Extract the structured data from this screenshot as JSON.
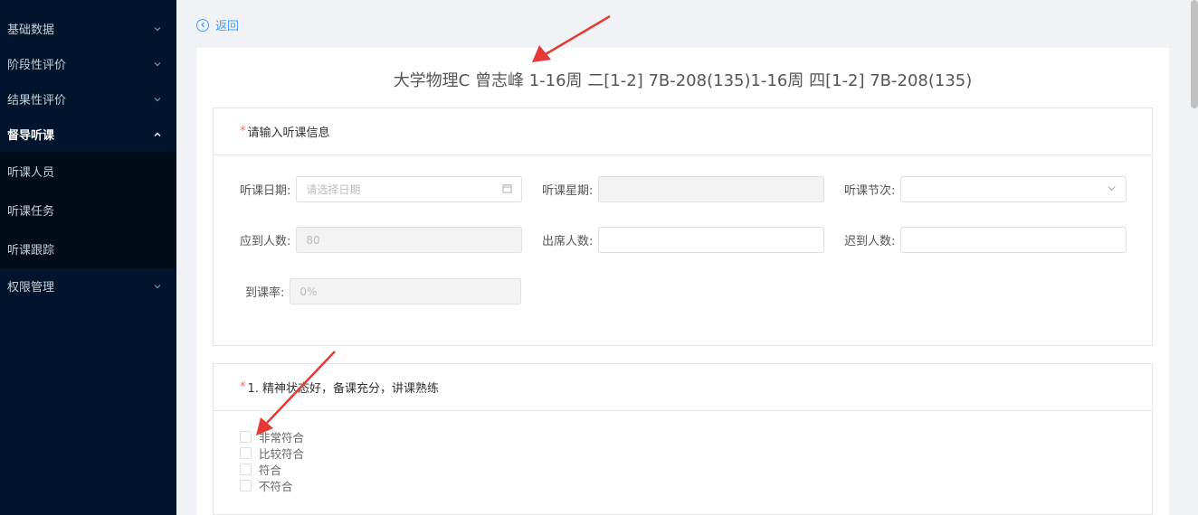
{
  "sidebar": {
    "items": [
      {
        "label": "基础数据",
        "chevron": "down"
      },
      {
        "label": "阶段性评价",
        "chevron": "down"
      },
      {
        "label": "结果性评价",
        "chevron": "down"
      },
      {
        "label": "督导听课",
        "chevron": "up",
        "active": true
      },
      {
        "label": "权限管理",
        "chevron": "down"
      }
    ],
    "submenu": [
      "听课人员",
      "听课任务",
      "听课跟踪"
    ]
  },
  "back_label": "返回",
  "course_title": "大学物理C 曾志峰 1-16周 二[1-2] 7B-208(135)1-16周 四[1-2] 7B-208(135)",
  "info_panel": {
    "required_mark": "*",
    "heading": "请输入听课信息",
    "fields": {
      "date": {
        "label": "听课日期:",
        "placeholder": "请选择日期",
        "icon": "calendar-icon"
      },
      "weekday": {
        "label": "听课星期:",
        "value": ""
      },
      "period": {
        "label": "听课节次:",
        "value": "",
        "icon": "chevron-down-icon"
      },
      "expected": {
        "label": "应到人数:",
        "value": "80"
      },
      "present": {
        "label": "出席人数:",
        "value": ""
      },
      "late": {
        "label": "迟到人数:",
        "value": ""
      },
      "rate": {
        "label": "到课率:",
        "value": "0%"
      }
    }
  },
  "question_panel": {
    "required_mark": "*",
    "heading": "1. 精神状态好，备课充分，讲课熟练",
    "options": [
      "非常符合",
      "比较符合",
      "符合",
      "不符合"
    ]
  },
  "colors": {
    "sidebar_bg": "#00152d",
    "submenu_bg": "#000c17",
    "accent": "#409eff",
    "required": "#f56c6c",
    "annotation_arrow": "#e53935"
  }
}
